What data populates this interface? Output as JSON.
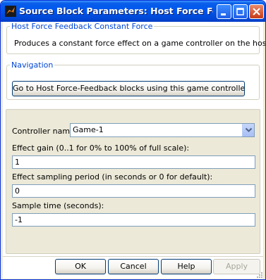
{
  "window": {
    "title": "Source Block Parameters: Host Force Feed..."
  },
  "block_info": {
    "heading": "Host Force Feedback Constant Force",
    "description": "Produces a constant force effect on a game controller on the host."
  },
  "navigation": {
    "heading": "Navigation",
    "goto_button": "Go to Host Force-Feedback blocks using this game controller..."
  },
  "parameters": {
    "controller_label": "Controller name:",
    "controller_value": "Game-1",
    "gain_label": "Effect gain (0..1 for 0% to 100% of full scale):",
    "gain_value": "1",
    "period_label": "Effect sampling period (in seconds or 0 for default):",
    "period_value": "0",
    "sample_label": "Sample time (seconds):",
    "sample_value": "-1"
  },
  "buttons": {
    "ok": "OK",
    "cancel": "Cancel",
    "help": "Help",
    "apply": "Apply"
  }
}
